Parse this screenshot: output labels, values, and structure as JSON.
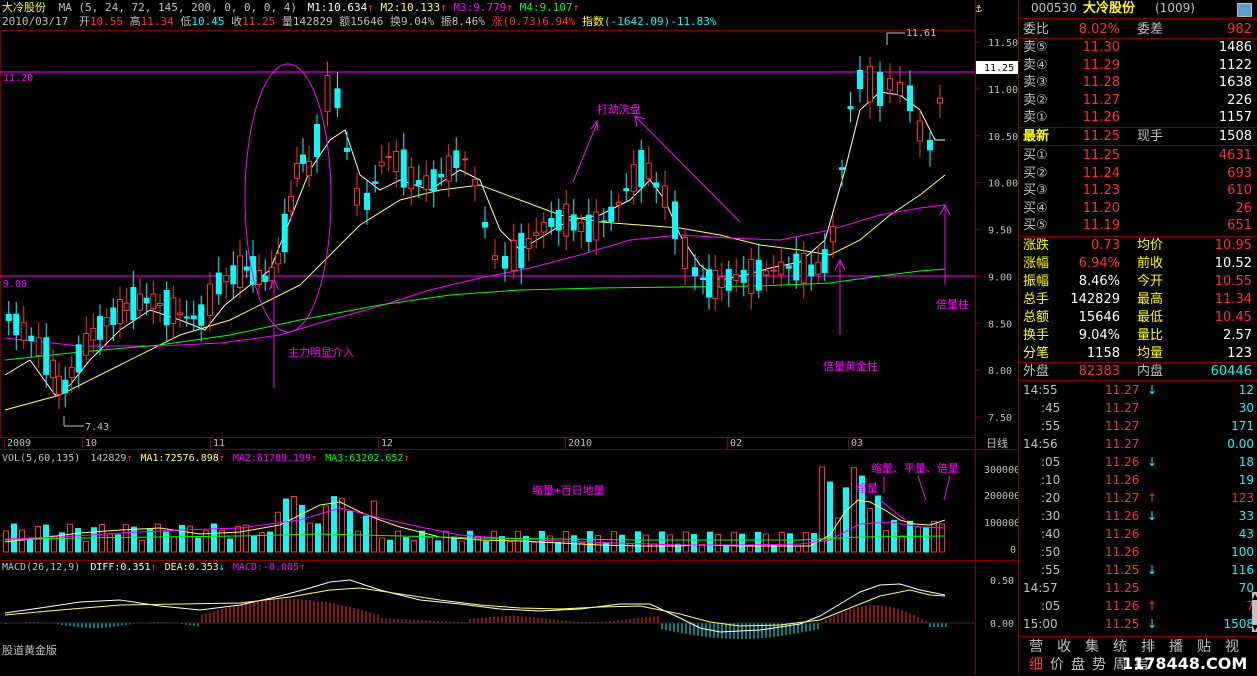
{
  "header": {
    "stock_name": "大冷股份",
    "ma_label": "MA (5, 24, 72, 145, 200, 0, 0, 0, 4)",
    "m1": "M1:10.634",
    "m2": "M2:10.133",
    "m3": "M3:9.779",
    "m4": "M4:9.107",
    "date": "2010/03/17",
    "open_label": "开",
    "open": "10.55",
    "high_label": "高",
    "high": "11.34",
    "low_label": "低",
    "low": "10.45",
    "close_label": "收",
    "close": "11.25",
    "vol_label": "量",
    "vol": "142829",
    "amt_label": "额",
    "amt": "15646",
    "turn_label": "换",
    "turn": "9.04%",
    "amp_label": "振",
    "amp": "8.46%",
    "chg_label": "涨",
    "chg": "(0.73)6.94%",
    "index_label": "指数",
    "index": "(-1642.09)-11.83%"
  },
  "price_axis": {
    "ticks": [
      "11.50",
      "11.00",
      "10.50",
      "10.00",
      "9.50",
      "9.00",
      "8.50",
      "8.00",
      "7.50"
    ],
    "current": "11.25",
    "line_hi": "11.20",
    "line_lo": "9.00"
  },
  "time_axis": {
    "labels": [
      "2009",
      "10",
      "11",
      "12",
      "2010",
      "02",
      "03"
    ],
    "period": "日线"
  },
  "annotations": {
    "hi_mark": "11.61",
    "lo_mark": "7.43",
    "main_force": "主力明显介入",
    "shakeout": "打劫洗盘",
    "double_gold": "倍量黄金柱",
    "double_col": "倍量柱",
    "shrink_100d": "缩量+百日地量",
    "shrink": "缩量",
    "shrink_half_double": "缩量、平量、倍量"
  },
  "vol_panel": {
    "title": "VOL(5,60,135)",
    "value": "142829",
    "ma1": "MA1:72576.898",
    "ma2": "MA2:61789.199",
    "ma3": "MA3:63202.652",
    "ticks": [
      "300000",
      "200000",
      "100000",
      "0"
    ]
  },
  "macd_panel": {
    "title": "MACD(26,12,9)",
    "diff": "DIFF:0.351",
    "dea": "DEA:0.353",
    "macd": "MACD:-0.005",
    "ticks": [
      "0.50",
      "0.00"
    ]
  },
  "watermark": "股道黄金版",
  "quote": {
    "code": "000530",
    "name": "大冷股份",
    "market": "(1009)",
    "weibi_label": "委比",
    "weibi": "8.02%",
    "weicha_label": "委差",
    "weicha": "982",
    "sells": [
      {
        "label": "卖⑤",
        "price": "11.30",
        "vol": "1486"
      },
      {
        "label": "卖④",
        "price": "11.29",
        "vol": "1122"
      },
      {
        "label": "卖③",
        "price": "11.28",
        "vol": "1638"
      },
      {
        "label": "卖②",
        "price": "11.27",
        "vol": "226"
      },
      {
        "label": "卖①",
        "price": "11.26",
        "vol": "1157"
      }
    ],
    "latest_label": "最新",
    "latest": "11.25",
    "xianshou_label": "现手",
    "xianshou": "1508",
    "buys": [
      {
        "label": "买①",
        "price": "11.25",
        "vol": "4631"
      },
      {
        "label": "买②",
        "price": "11.24",
        "vol": "693"
      },
      {
        "label": "买③",
        "price": "11.23",
        "vol": "610"
      },
      {
        "label": "买④",
        "price": "11.20",
        "vol": "26"
      },
      {
        "label": "买⑤",
        "price": "11.19",
        "vol": "651"
      }
    ],
    "stats": [
      {
        "l1": "涨跌",
        "v1": "0.73",
        "l2": "均价",
        "v2": "10.95"
      },
      {
        "l1": "涨幅",
        "v1": "6.94%",
        "l2": "前收",
        "v2": "10.52"
      },
      {
        "l1": "振幅",
        "v1": "8.46%",
        "l2": "今开",
        "v2": "10.55"
      },
      {
        "l1": "总手",
        "v1": "142829",
        "l2": "最高",
        "v2": "11.34"
      },
      {
        "l1": "总额",
        "v1": "15646",
        "l2": "最低",
        "v2": "10.45"
      },
      {
        "l1": "换手",
        "v1": "9.04%",
        "l2": "量比",
        "v2": "2.57"
      },
      {
        "l1": "分笔",
        "v1": "1158",
        "l2": "均量",
        "v2": "123"
      }
    ],
    "outer_label": "外盘",
    "outer": "82383",
    "inner_label": "内盘",
    "inner": "60446",
    "ticks": [
      {
        "time": "14:55",
        "price": "11.27",
        "arrow": "down",
        "vol": "12"
      },
      {
        "time": ":45",
        "price": "11.27",
        "arrow": "",
        "vol": "30"
      },
      {
        "time": ":55",
        "price": "11.27",
        "arrow": "",
        "vol": "171"
      },
      {
        "time": "14:56",
        "price": "11.27",
        "arrow": "",
        "vol": "0.00"
      },
      {
        "time": ":05",
        "price": "11.26",
        "arrow": "down",
        "vol": "18"
      },
      {
        "time": ":10",
        "price": "11.26",
        "arrow": "",
        "vol": "19"
      },
      {
        "time": ":20",
        "price": "11.27",
        "arrow": "up",
        "vol": "123"
      },
      {
        "time": ":30",
        "price": "11.26",
        "arrow": "down",
        "vol": "33"
      },
      {
        "time": ":40",
        "price": "11.26",
        "arrow": "",
        "vol": "43"
      },
      {
        "time": ":50",
        "price": "11.26",
        "arrow": "",
        "vol": "100"
      },
      {
        "time": ":55",
        "price": "11.25",
        "arrow": "down",
        "vol": "116"
      },
      {
        "time": "14:57",
        "price": "11.25",
        "arrow": "",
        "vol": "70"
      },
      {
        "time": ":05",
        "price": "11.26",
        "arrow": "up",
        "vol": "7"
      },
      {
        "time": "15:00",
        "price": "11.25",
        "arrow": "down",
        "vol": "1508"
      }
    ],
    "nav_top": [
      "营",
      "收",
      "集",
      "统",
      "排",
      "播",
      "贴",
      "视"
    ],
    "nav_bottom": [
      "细",
      "价",
      "盘",
      "势",
      "周",
      "指"
    ],
    "watermark": "1178448.COM"
  },
  "colors": {
    "up": "#ff3030",
    "down": "#00ffff",
    "ma5": "#ffffff",
    "ma24": "#ffff66",
    "ma72": "#ff00ff",
    "ma145": "#00ff00",
    "accent": "#ffff00"
  }
}
